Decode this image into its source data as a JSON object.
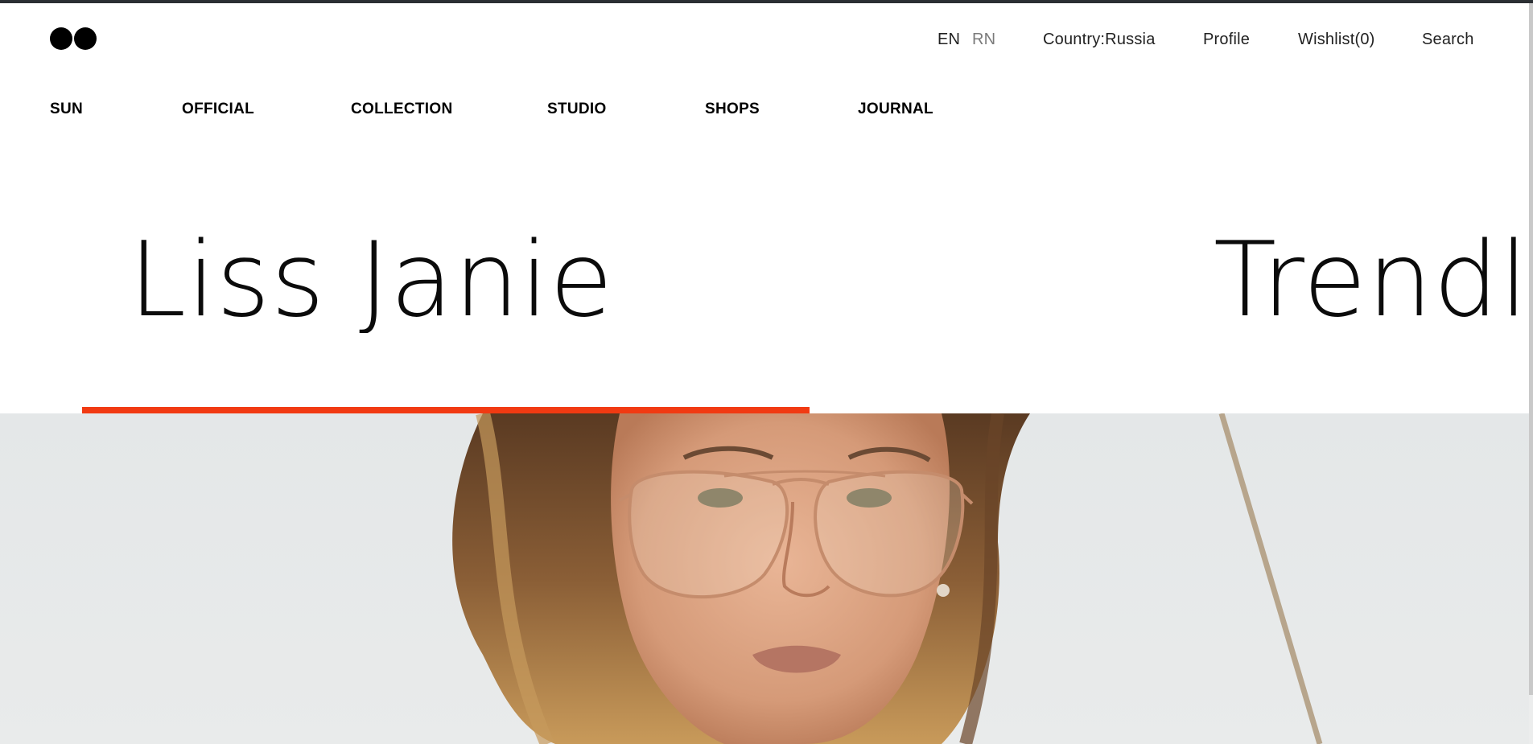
{
  "header": {
    "logo_icon": "two-dots-logo",
    "languages": [
      {
        "label": "EN",
        "active": true
      },
      {
        "label": "RN",
        "active": false
      }
    ],
    "country": "Country:Russia",
    "profile": "Profile",
    "wishlist": "Wishlist(0)",
    "search": "Search"
  },
  "nav": {
    "items": [
      {
        "label": "SUN"
      },
      {
        "label": "OFFICIAL"
      },
      {
        "label": "COLLECTION"
      },
      {
        "label": "STUDIO"
      },
      {
        "label": "SHOPS"
      },
      {
        "label": "JOURNAL"
      }
    ]
  },
  "hero": {
    "marquee": [
      "Liss Janie",
      "Trendli"
    ],
    "accent_color": "#f13a12",
    "image": "woman-in-aviator-glasses"
  }
}
